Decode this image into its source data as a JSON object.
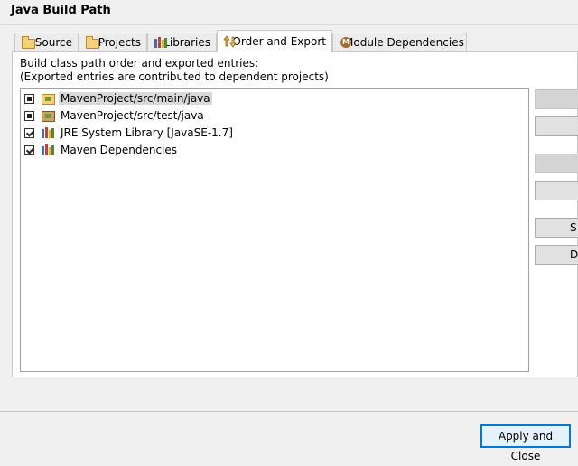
{
  "window": {
    "title": "Java Build Path"
  },
  "tabs": [
    {
      "label": "Source",
      "icon": "source-folder-icon"
    },
    {
      "label": "Projects",
      "icon": "projects-folder-icon"
    },
    {
      "label": "Libraries",
      "icon": "libraries-icon"
    },
    {
      "label": "Order and Export",
      "icon": "order-export-icon",
      "active": true
    },
    {
      "label": "Module Dependencies",
      "icon": "module-icon"
    }
  ],
  "panel": {
    "description_line1": "Build class path order and exported entries:",
    "description_line2": "(Exported entries are contributed to dependent projects)"
  },
  "entries": [
    {
      "label": "MavenProject/src/main/java",
      "state": "partial",
      "icon": "source-folder-icon",
      "selected": true
    },
    {
      "label": "MavenProject/src/test/java",
      "state": "partial",
      "icon": "source-folder-icon"
    },
    {
      "label": "JRE System Library [JavaSE-1.7]",
      "state": "checked",
      "icon": "library-icon"
    },
    {
      "label": "Maven Dependencies",
      "state": "checked",
      "icon": "library-icon"
    }
  ],
  "side_buttons": [
    {
      "label": "",
      "disabled": true
    },
    {
      "label": "",
      "disabled": false
    },
    {
      "label": "",
      "disabled": true
    },
    {
      "label": "",
      "disabled": false
    },
    {
      "label": "S",
      "disabled": false
    },
    {
      "label": "D",
      "disabled": false
    }
  ],
  "footer": {
    "apply_label": "Apply and Close"
  }
}
